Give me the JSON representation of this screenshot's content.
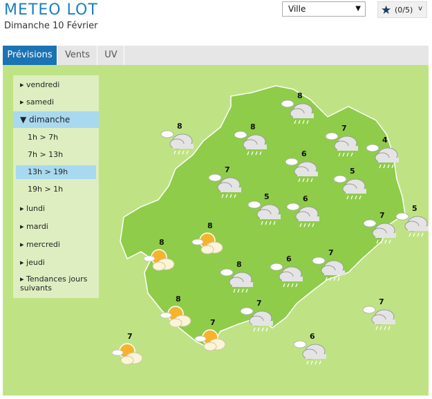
{
  "header": {
    "title": "METEO LOT",
    "date": "Dimanche 10 Février"
  },
  "city_select": {
    "value": "Ville"
  },
  "favorites": {
    "count_label": "(0/5)"
  },
  "tabs": [
    "Prévisions",
    "Vents",
    "UV"
  ],
  "days": {
    "before": [
      "vendredi",
      "samedi"
    ],
    "active": "dimanche",
    "slots": [
      "1h > 7h",
      "7h > 13h",
      "13h > 19h",
      "19h > 1h"
    ],
    "active_slot": "13h > 19h",
    "after": [
      "lundi",
      "mardi",
      "mercredi",
      "jeudi"
    ],
    "trends": "Tendances jours suivants"
  },
  "forecasts": {
    "p01": "8",
    "p02": "8",
    "p03": "7",
    "p04": "4",
    "p05": "8",
    "p06": "7",
    "p07": "6",
    "p08": "5",
    "p09": "5",
    "p10": "6",
    "p11": "7",
    "p12": "5",
    "p13": "7",
    "p14": "8",
    "p15": "8",
    "p16": "6",
    "p17": "7",
    "p18": "8",
    "p19": "7",
    "p20": "7",
    "p21": "7",
    "p22": "6",
    "p23": "8"
  },
  "colors": {
    "brand": "#1a7fbf",
    "active_tab": "#1b73b3",
    "map_bg": "#bfe384",
    "dept": "#8fcc4a",
    "selected": "#a9d9f0"
  },
  "icons": {
    "rain": "rain-cloud-icon",
    "sun": "sun-cloud-icon"
  }
}
